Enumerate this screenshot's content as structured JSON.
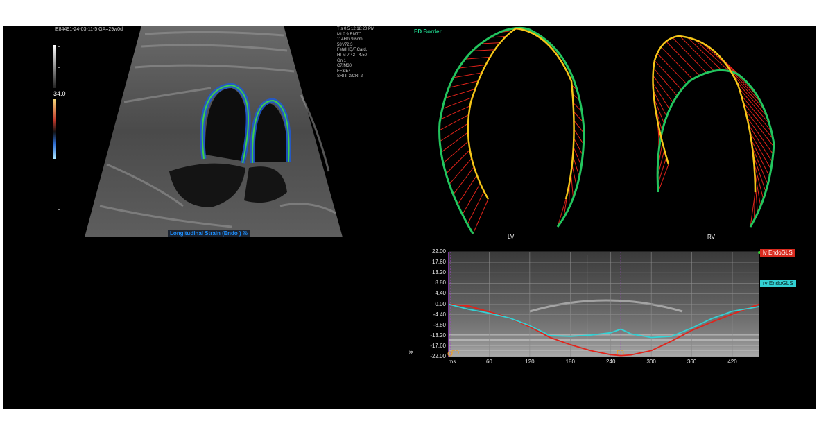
{
  "ultrasound": {
    "top_info": "E84491-24-03-11-5   GA=29w0d",
    "params": [
      "TIs  0.5    12:18:20 PM",
      "MI  0.9          RM7C",
      "114Hz/ 9.6cm",
      "58°/72.3",
      "FetalHQ/F.Card.",
      "HI M  7.42 - 4.50",
      "Gn  1",
      "C7/M30",
      "FF3/E4",
      "SRI II 3/CRI 2"
    ],
    "scale_value": "34.0",
    "strain_label": "Longitudinal Strain (Endo ) %"
  },
  "borders": {
    "title": "ED Border",
    "lv_label": "LV",
    "rv_label": "RV"
  },
  "colors": {
    "lv": "#e2231a",
    "rv": "#33d1d4",
    "ed_border": "#22c55e",
    "es_border": "#f5c518"
  },
  "chart_data": {
    "type": "line",
    "title": "",
    "xlabel": "ms",
    "ylabel": "%",
    "xlim": [
      0,
      460
    ],
    "ylim": [
      -22,
      22
    ],
    "yticks": [
      "22.00",
      "17.60",
      "13.20",
      "8.80",
      "4.40",
      "0.00",
      "-4.40",
      "-8.80",
      "-13.20",
      "-17.60",
      "-22.00"
    ],
    "ytick_values": [
      22,
      17.6,
      13.2,
      8.8,
      4.4,
      0,
      -4.4,
      -8.8,
      -13.2,
      -17.6,
      -22
    ],
    "xticks": [
      "60",
      "120",
      "180",
      "240",
      "300",
      "360",
      "420"
    ],
    "xtick_values": [
      60,
      120,
      180,
      240,
      300,
      360,
      420
    ],
    "x_origin_label": "ms",
    "markers": {
      "ed": "ED",
      "es": "ES",
      "es_x": 255
    },
    "series": [
      {
        "name": "lv EndoGLS",
        "color": "#e2231a",
        "x": [
          0,
          30,
          60,
          90,
          120,
          150,
          180,
          210,
          240,
          255,
          270,
          300,
          330,
          360,
          390,
          420,
          450,
          460
        ],
        "y": [
          0,
          -0.8,
          -3.2,
          -5.8,
          -9.5,
          -14.0,
          -17.0,
          -19.5,
          -21.2,
          -21.6,
          -21.3,
          -19.5,
          -15.5,
          -11.0,
          -7.5,
          -4.2,
          -1.0,
          0
        ]
      },
      {
        "name": "rv EndoGLS",
        "color": "#33d1d4",
        "x": [
          0,
          30,
          60,
          90,
          120,
          150,
          180,
          210,
          240,
          255,
          270,
          300,
          330,
          360,
          390,
          420,
          450,
          460
        ],
        "y": [
          0,
          -2.2,
          -3.8,
          -5.8,
          -9.0,
          -13.2,
          -13.5,
          -13.0,
          -12.0,
          -10.5,
          -12.5,
          -14.0,
          -13.5,
          -10.0,
          -6.0,
          -3.0,
          -1.5,
          -1.0
        ]
      }
    ]
  }
}
